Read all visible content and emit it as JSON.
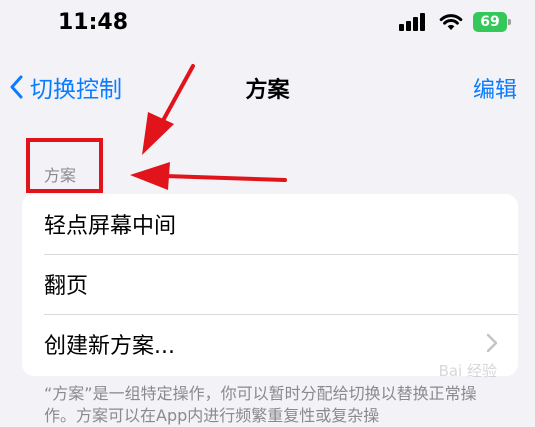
{
  "status": {
    "time": "11:48",
    "battery": "69"
  },
  "nav": {
    "back_label": "切换控制",
    "title": "方案",
    "edit_label": "编辑"
  },
  "section": {
    "header": "方案"
  },
  "list": {
    "items": [
      {
        "label": "轻点屏幕中间"
      },
      {
        "label": "翻页"
      },
      {
        "label": "创建新方案..."
      }
    ]
  },
  "footer": {
    "text": "“方案”是一组特定操作，你可以暂时分配给切换以替换正常操作。方案可以在App内进行频繁重复性或复杂操"
  },
  "watermark": {
    "text": "Bai 经验"
  },
  "annotation_color": "#e0141a",
  "accent_color": "#0a7cff"
}
